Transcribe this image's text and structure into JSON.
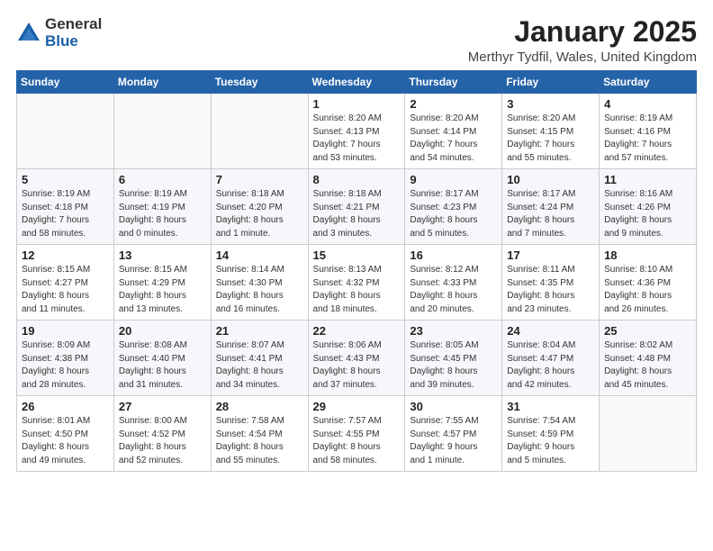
{
  "logo": {
    "general": "General",
    "blue": "Blue"
  },
  "title": "January 2025",
  "location": "Merthyr Tydfil, Wales, United Kingdom",
  "days_header": [
    "Sunday",
    "Monday",
    "Tuesday",
    "Wednesday",
    "Thursday",
    "Friday",
    "Saturday"
  ],
  "weeks": [
    [
      {
        "day": "",
        "info": ""
      },
      {
        "day": "",
        "info": ""
      },
      {
        "day": "",
        "info": ""
      },
      {
        "day": "1",
        "info": "Sunrise: 8:20 AM\nSunset: 4:13 PM\nDaylight: 7 hours\nand 53 minutes."
      },
      {
        "day": "2",
        "info": "Sunrise: 8:20 AM\nSunset: 4:14 PM\nDaylight: 7 hours\nand 54 minutes."
      },
      {
        "day": "3",
        "info": "Sunrise: 8:20 AM\nSunset: 4:15 PM\nDaylight: 7 hours\nand 55 minutes."
      },
      {
        "day": "4",
        "info": "Sunrise: 8:19 AM\nSunset: 4:16 PM\nDaylight: 7 hours\nand 57 minutes."
      }
    ],
    [
      {
        "day": "5",
        "info": "Sunrise: 8:19 AM\nSunset: 4:18 PM\nDaylight: 7 hours\nand 58 minutes."
      },
      {
        "day": "6",
        "info": "Sunrise: 8:19 AM\nSunset: 4:19 PM\nDaylight: 8 hours\nand 0 minutes."
      },
      {
        "day": "7",
        "info": "Sunrise: 8:18 AM\nSunset: 4:20 PM\nDaylight: 8 hours\nand 1 minute."
      },
      {
        "day": "8",
        "info": "Sunrise: 8:18 AM\nSunset: 4:21 PM\nDaylight: 8 hours\nand 3 minutes."
      },
      {
        "day": "9",
        "info": "Sunrise: 8:17 AM\nSunset: 4:23 PM\nDaylight: 8 hours\nand 5 minutes."
      },
      {
        "day": "10",
        "info": "Sunrise: 8:17 AM\nSunset: 4:24 PM\nDaylight: 8 hours\nand 7 minutes."
      },
      {
        "day": "11",
        "info": "Sunrise: 8:16 AM\nSunset: 4:26 PM\nDaylight: 8 hours\nand 9 minutes."
      }
    ],
    [
      {
        "day": "12",
        "info": "Sunrise: 8:15 AM\nSunset: 4:27 PM\nDaylight: 8 hours\nand 11 minutes."
      },
      {
        "day": "13",
        "info": "Sunrise: 8:15 AM\nSunset: 4:29 PM\nDaylight: 8 hours\nand 13 minutes."
      },
      {
        "day": "14",
        "info": "Sunrise: 8:14 AM\nSunset: 4:30 PM\nDaylight: 8 hours\nand 16 minutes."
      },
      {
        "day": "15",
        "info": "Sunrise: 8:13 AM\nSunset: 4:32 PM\nDaylight: 8 hours\nand 18 minutes."
      },
      {
        "day": "16",
        "info": "Sunrise: 8:12 AM\nSunset: 4:33 PM\nDaylight: 8 hours\nand 20 minutes."
      },
      {
        "day": "17",
        "info": "Sunrise: 8:11 AM\nSunset: 4:35 PM\nDaylight: 8 hours\nand 23 minutes."
      },
      {
        "day": "18",
        "info": "Sunrise: 8:10 AM\nSunset: 4:36 PM\nDaylight: 8 hours\nand 26 minutes."
      }
    ],
    [
      {
        "day": "19",
        "info": "Sunrise: 8:09 AM\nSunset: 4:38 PM\nDaylight: 8 hours\nand 28 minutes."
      },
      {
        "day": "20",
        "info": "Sunrise: 8:08 AM\nSunset: 4:40 PM\nDaylight: 8 hours\nand 31 minutes."
      },
      {
        "day": "21",
        "info": "Sunrise: 8:07 AM\nSunset: 4:41 PM\nDaylight: 8 hours\nand 34 minutes."
      },
      {
        "day": "22",
        "info": "Sunrise: 8:06 AM\nSunset: 4:43 PM\nDaylight: 8 hours\nand 37 minutes."
      },
      {
        "day": "23",
        "info": "Sunrise: 8:05 AM\nSunset: 4:45 PM\nDaylight: 8 hours\nand 39 minutes."
      },
      {
        "day": "24",
        "info": "Sunrise: 8:04 AM\nSunset: 4:47 PM\nDaylight: 8 hours\nand 42 minutes."
      },
      {
        "day": "25",
        "info": "Sunrise: 8:02 AM\nSunset: 4:48 PM\nDaylight: 8 hours\nand 45 minutes."
      }
    ],
    [
      {
        "day": "26",
        "info": "Sunrise: 8:01 AM\nSunset: 4:50 PM\nDaylight: 8 hours\nand 49 minutes."
      },
      {
        "day": "27",
        "info": "Sunrise: 8:00 AM\nSunset: 4:52 PM\nDaylight: 8 hours\nand 52 minutes."
      },
      {
        "day": "28",
        "info": "Sunrise: 7:58 AM\nSunset: 4:54 PM\nDaylight: 8 hours\nand 55 minutes."
      },
      {
        "day": "29",
        "info": "Sunrise: 7:57 AM\nSunset: 4:55 PM\nDaylight: 8 hours\nand 58 minutes."
      },
      {
        "day": "30",
        "info": "Sunrise: 7:55 AM\nSunset: 4:57 PM\nDaylight: 9 hours\nand 1 minute."
      },
      {
        "day": "31",
        "info": "Sunrise: 7:54 AM\nSunset: 4:59 PM\nDaylight: 9 hours\nand 5 minutes."
      },
      {
        "day": "",
        "info": ""
      }
    ]
  ]
}
